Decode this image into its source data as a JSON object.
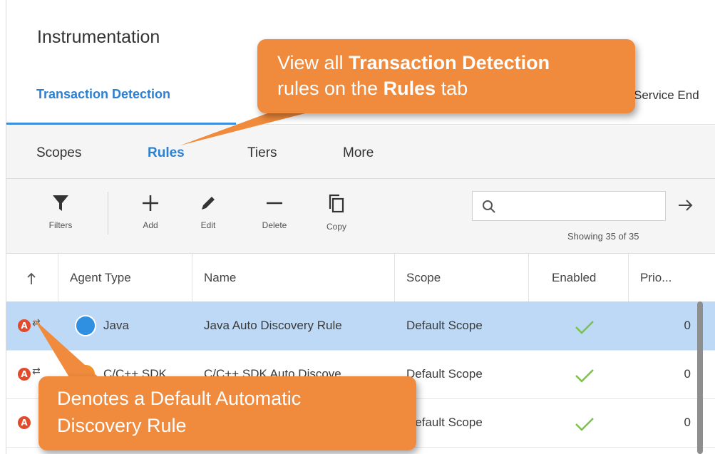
{
  "page": {
    "title": "Instrumentation"
  },
  "tabs": {
    "active": "Transaction Detection",
    "other": "Service End"
  },
  "subnav": {
    "items": [
      "Scopes",
      "Rules",
      "Tiers",
      "More"
    ],
    "active": "Rules"
  },
  "toolbar": {
    "filters": "Filters",
    "add": "Add",
    "edit": "Edit",
    "delete": "Delete",
    "copy": "Copy",
    "search_value": "",
    "showing": "Showing 35 of 35"
  },
  "table": {
    "columns": [
      "Agent Type",
      "Name",
      "Scope",
      "Enabled",
      "Prio..."
    ],
    "rows": [
      {
        "badge": "A",
        "agent_type": "Java",
        "agent_color": "#2f8fe0",
        "name": "Java Auto Discovery Rule",
        "scope": "Default Scope",
        "enabled": true,
        "priority": "0",
        "selected": true
      },
      {
        "badge": "A",
        "agent_type": "C/C++ SDK",
        "agent_color": "#f29322",
        "name": "C/C++ SDK Auto Discove...",
        "scope": "Default Scope",
        "enabled": true,
        "priority": "0",
        "selected": false
      },
      {
        "badge": "A",
        "agent_type": "",
        "agent_color": "#e24a2b",
        "name": "",
        "scope": "Default Scope",
        "enabled": true,
        "priority": "0",
        "selected": false
      }
    ]
  },
  "callouts": {
    "top": {
      "prefix": "View all ",
      "bold1": "Transaction Detection",
      "middle": "rules on the ",
      "bold2": "Rules",
      "suffix": " tab"
    },
    "bottom": {
      "line1": "Denotes a Default Automatic",
      "line2": "Discovery Rule"
    }
  },
  "colors": {
    "accent": "#2d7fd0",
    "callout": "#f08a3c",
    "selected_row": "#bdd9f5",
    "check": "#7bc24a"
  }
}
